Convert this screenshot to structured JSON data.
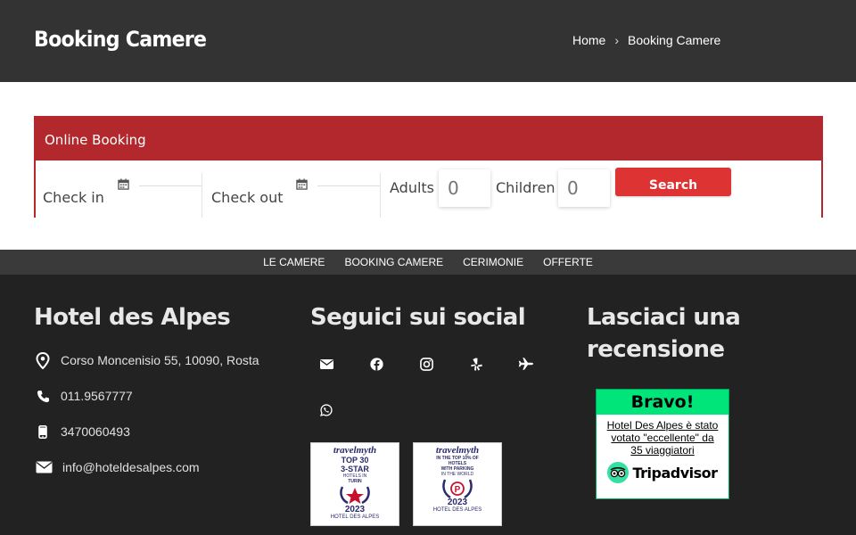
{
  "header": {
    "title": "Booking Camere",
    "breadcrumb": {
      "home": "Home",
      "separator": "›",
      "current": "Booking Camere"
    }
  },
  "booking": {
    "heading": "Online Booking",
    "checkin_label": "Check in",
    "checkout_label": "Check out",
    "adults_label": "Adults",
    "adults_placeholder": "0",
    "children_label": "Children",
    "children_placeholder": "0",
    "search_label": "Search"
  },
  "nav": {
    "items": [
      "LE CAMERE",
      "BOOKING CAMERE",
      "CERIMONIE",
      "OFFERTE"
    ]
  },
  "footer": {
    "hotel": {
      "title": "Hotel des Alpes",
      "address": "Corso Moncenisio 55, 10090, Rosta",
      "phone": "011.9567777",
      "mobile": "3470060493",
      "email": "info@hoteldesalpes.com"
    },
    "social": {
      "title": "Seguici sui social",
      "icons": [
        "envelope-icon",
        "facebook-icon",
        "instagram-icon",
        "yelp-icon",
        "plane-icon",
        "whatsapp-icon"
      ],
      "badges": [
        {
          "brand": "travelmyth",
          "line1": "TOP 30",
          "line2": "3-STAR",
          "line3": "HOTELS IN",
          "line4": "TURIN",
          "year": "2023",
          "name": "HOTEL DES ALPES"
        },
        {
          "brand": "travelmyth",
          "line1": "IN THE TOP 10% OF",
          "line2": "HOTELS",
          "line3": "WITH PARKING",
          "line4": "IN THE WORLD",
          "year": "2023",
          "name": "HOTEL DES ALPES"
        }
      ]
    },
    "review": {
      "title": "Lasciaci una recensione",
      "bravo": "Bravo!",
      "text": "Hotel Des Alpes è stato votato \"eccellente\" da 35 viaggiatori",
      "logo_text": "Tripadvisor"
    }
  },
  "colors": {
    "header_bg": "#333333",
    "accent_red": "#b3282d",
    "button_red": "#dd3333",
    "footer_bg": "#222222",
    "tripadvisor_green": "#00e57a"
  }
}
